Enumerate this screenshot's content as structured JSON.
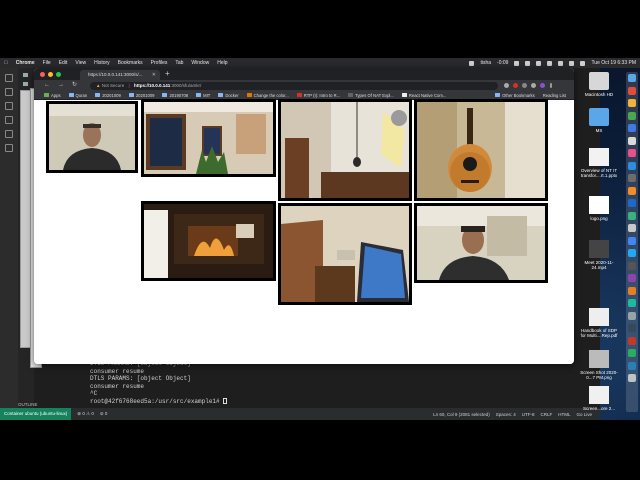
{
  "menubar": {
    "app": "Chrome",
    "items": [
      "File",
      "Edit",
      "View",
      "History",
      "Bookmarks",
      "Profiles",
      "Tab",
      "Window",
      "Help"
    ],
    "status_user": "tisha",
    "status_timer": "-0:09",
    "clock": "Tue Oct 19  6:33 PM"
  },
  "browser": {
    "tab_title": "https://10.0.0.141:3000/s/...",
    "omnibox": {
      "security": "Not Secure",
      "separator": "|",
      "host": "https://10.0.0.141",
      "path": ":3000/sfu/amkr/"
    },
    "bookmarks": [
      "Apps",
      "Quran",
      "20201009",
      "20201009",
      "20190708",
      "MIT",
      "Docker",
      "Change the color...",
      "RTP (I): Intro to R...",
      "Types Of NAT Expl...",
      "React Native Com..."
    ],
    "bookmarks_right": [
      "Other Bookmarks",
      "Reading List"
    ]
  },
  "videos": [
    {
      "label": "participant-man-headphones"
    },
    {
      "label": "room-window-plant"
    },
    {
      "label": "ceiling-light"
    },
    {
      "label": "guitar"
    },
    {
      "label": "fireplace"
    },
    {
      "label": "door-laptop"
    },
    {
      "label": "participant-man-2"
    }
  ],
  "vscode": {
    "terminal": [
      "DTLS PARAMS: [object Object]",
      "consumer resume",
      "DTLS PARAMS: [object Object]",
      "consumer resume",
      "^C",
      "root@42f6768eed5a:/usr/src/example1#"
    ],
    "remote": "Container ubuntu (ubuntu-linux)",
    "outline": "OUTLINE",
    "status_left": [
      "⊗ 0  ⚠ 0",
      "⊘ 0"
    ],
    "status_right": [
      "Ln 60, Col 9 (2081 selected)",
      "Spaces: 4",
      "UTF-8",
      "CRLF",
      "HTML",
      "Go Live"
    ]
  },
  "desktop": {
    "icons": [
      {
        "name": "Macintosh HD"
      },
      {
        "name": "MS"
      },
      {
        "name": "Overview of NT IT transfor....rt.1.pptx"
      },
      {
        "name": "logo.png"
      },
      {
        "name": "Meet 2020-11-24.mp4"
      },
      {
        "name": "Handbook of SDP for Multi....Rep.pdf"
      },
      {
        "name": "Screen Shot 2020-0...7 PM.png"
      },
      {
        "name": "Screen...ore 2..."
      }
    ]
  },
  "colors": {
    "traffic_red": "#ff5f57",
    "traffic_yellow": "#febc2e",
    "traffic_green": "#28c840",
    "vscode_remote": "#16825d"
  }
}
